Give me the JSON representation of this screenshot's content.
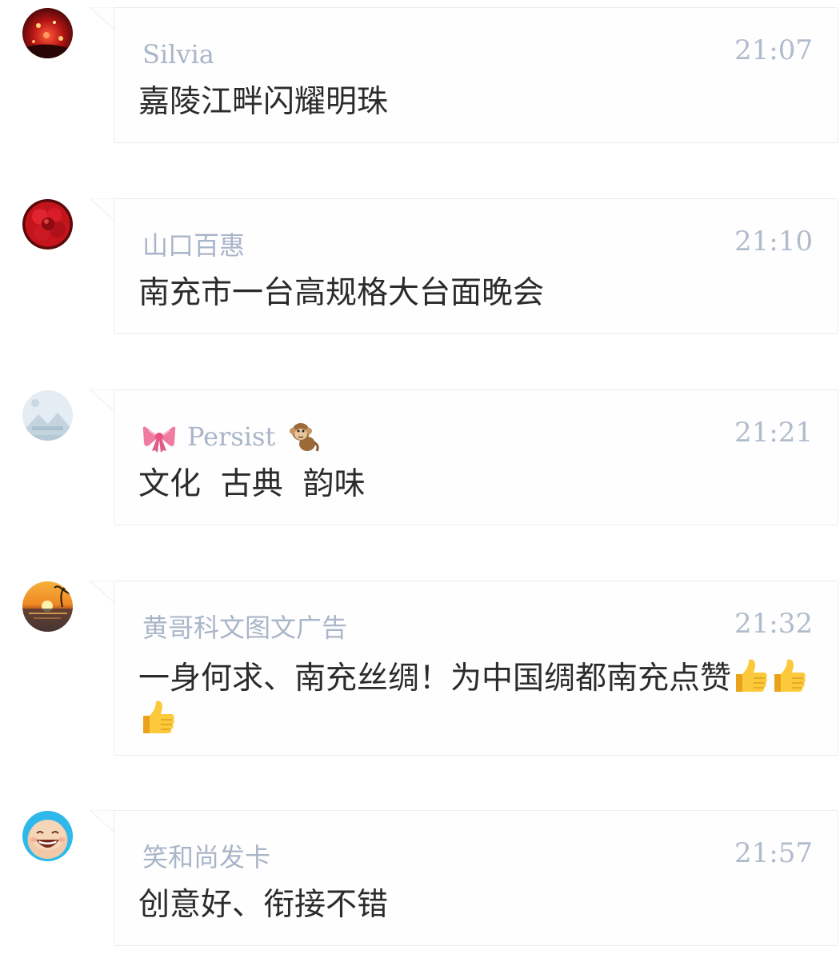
{
  "comments": [
    {
      "name": "Silvia",
      "time": "21:07",
      "text": "嘉陵江畔闪耀明珠",
      "avatar": "avatar-fireworks-red"
    },
    {
      "name": "山口百惠",
      "time": "21:10",
      "text": "南充市一台高规格大台面晚会",
      "avatar": "avatar-red-flower"
    },
    {
      "name": "Persist",
      "time": "21:21",
      "text": "文化  古典  韵味",
      "avatar": "avatar-placeholder-landscape",
      "name_prefix_icon": "ribbon-icon",
      "name_suffix_icon": "monkey-icon"
    },
    {
      "name": "黄哥科文图文广告",
      "time": "21:32",
      "text": "一身何求、南充丝绸！为中国绸都南充点赞",
      "avatar": "avatar-sunset-beach",
      "trailing_emoji": [
        "thumbs-up-icon",
        "thumbs-up-icon",
        "thumbs-up-icon"
      ]
    },
    {
      "name": "笑和尚发卡",
      "time": "21:57",
      "text": "创意好、衔接不错",
      "avatar": "avatar-laughing-buddha"
    }
  ],
  "colors": {
    "name": "#a9b5c8",
    "time": "#b0bccc",
    "text": "#2b2b2b",
    "bubble_border": "#ececec"
  }
}
